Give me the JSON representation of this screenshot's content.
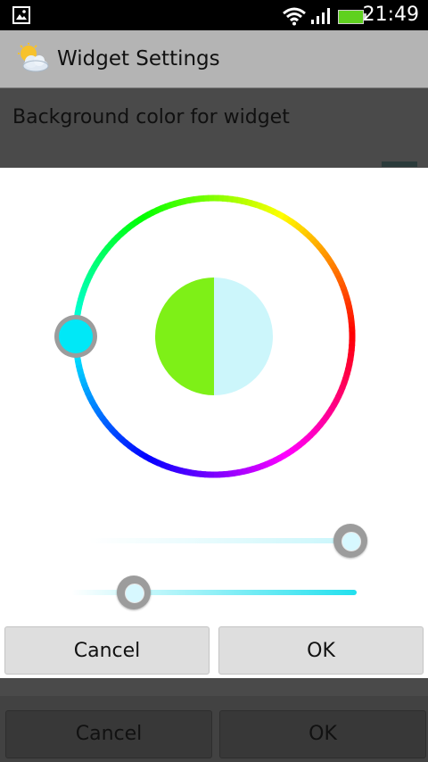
{
  "status_bar": {
    "time": "21:49",
    "icons": [
      "gallery-icon",
      "wifi-icon",
      "signal-icon",
      "battery-icon"
    ],
    "battery_color": "#5fd11f"
  },
  "title_bar": {
    "title": "Widget Settings",
    "icon": "weather-icon"
  },
  "settings": {
    "preference_title": "Background color for widget",
    "buttons": {
      "cancel": "Cancel",
      "ok": "OK"
    }
  },
  "color_picker": {
    "old_color": "#7ef017",
    "new_color": "#ccf6fb",
    "hue_marker_color": "#00e8f7",
    "saturation_value": 1.0,
    "value_value": 0.2,
    "buttons": {
      "cancel": "Cancel",
      "ok": "OK"
    }
  }
}
